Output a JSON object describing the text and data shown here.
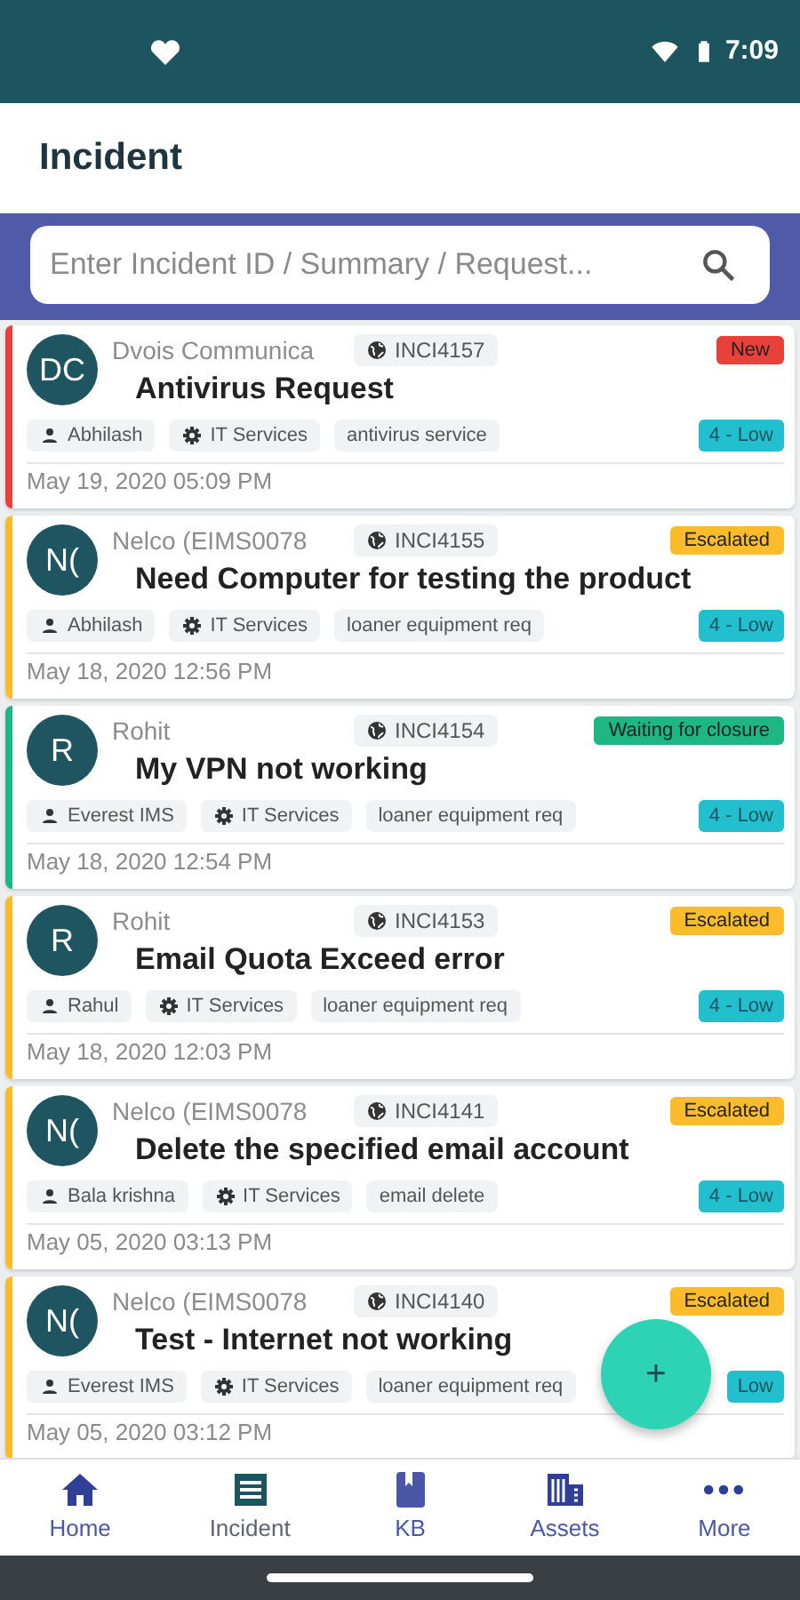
{
  "status_bar": {
    "time": "7:09"
  },
  "header": {
    "title": "Incident"
  },
  "search": {
    "placeholder": "Enter Incident ID / Summary / Request..."
  },
  "incidents": [
    {
      "initials": "DC",
      "requester": "Dvois Communica",
      "id": "INCI4157",
      "status": "New",
      "color": "#e8413a",
      "title": "Antivirus Request",
      "assignee": "Abhilash",
      "group": "IT Services",
      "category": "antivirus service",
      "priority": "4 - Low",
      "date": "May 19, 2020 05:09 PM"
    },
    {
      "initials": "N(",
      "requester": "Nelco (EIMS0078",
      "id": "INCI4155",
      "status": "Escalated",
      "color": "#fbbc2c",
      "title": "Need Computer for testing the product",
      "assignee": "Abhilash",
      "group": "IT Services",
      "category": "loaner equipment req",
      "priority": "4 - Low",
      "date": "May 18, 2020 12:56 PM"
    },
    {
      "initials": "R",
      "requester": "Rohit",
      "id": "INCI4154",
      "status": "Waiting for closure",
      "color": "#1eb784",
      "title": "My VPN not working",
      "assignee": "Everest IMS",
      "group": "IT Services",
      "category": "loaner equipment req",
      "priority": "4 - Low",
      "date": "May 18, 2020 12:54 PM"
    },
    {
      "initials": "R",
      "requester": "Rohit",
      "id": "INCI4153",
      "status": "Escalated",
      "color": "#fbbc2c",
      "title": "Email Quota Exceed error",
      "assignee": "Rahul",
      "group": "IT Services",
      "category": "loaner equipment req",
      "priority": "4 - Low",
      "date": "May 18, 2020 12:03 PM"
    },
    {
      "initials": "N(",
      "requester": "Nelco (EIMS0078",
      "id": "INCI4141",
      "status": "Escalated",
      "color": "#fbbc2c",
      "title": "Delete the specified email account",
      "assignee": "Bala krishna",
      "group": "IT Services",
      "category": "email delete",
      "priority": "4 - Low",
      "date": "May 05, 2020 03:13 PM"
    },
    {
      "initials": "N(",
      "requester": "Nelco (EIMS0078",
      "id": "INCI4140",
      "status": "Escalated",
      "color": "#fbbc2c",
      "title": "Test - Internet not working",
      "assignee": "Everest IMS",
      "group": "IT Services",
      "category": "loaner equipment req",
      "priority": "Low",
      "date": "May 05, 2020 03:12 PM"
    }
  ],
  "fab": {
    "label": "+"
  },
  "bottom_nav": [
    {
      "label": "Home",
      "selected": false
    },
    {
      "label": "Incident",
      "selected": true
    },
    {
      "label": "KB",
      "selected": false
    },
    {
      "label": "Assets",
      "selected": false
    },
    {
      "label": "More",
      "selected": false
    }
  ]
}
